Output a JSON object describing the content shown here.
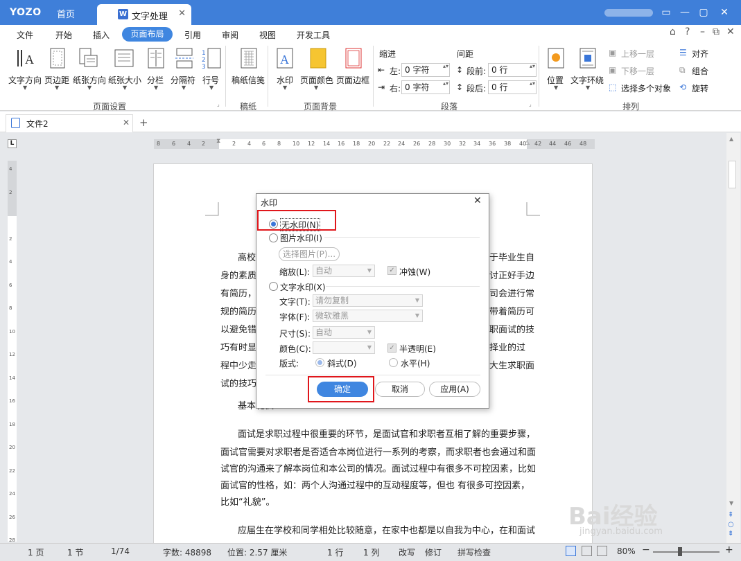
{
  "titlebar": {
    "logo": "YOZO",
    "home_tab": "首页",
    "doc_tab": "文字处理",
    "doc_tab_icon": "W",
    "close": "✕",
    "win_buttons": [
      "▭",
      "—",
      "▢",
      "✕"
    ]
  },
  "menu": {
    "items": [
      "文件",
      "开始",
      "插入",
      "页面布局",
      "引用",
      "审阅",
      "视图",
      "开发工具"
    ],
    "active": "页面布局",
    "right_icons": [
      "⌂",
      "?",
      "–",
      "⧉",
      "✕"
    ]
  },
  "ribbon": {
    "page_setup": {
      "buttons": [
        "文字方向",
        "页边距",
        "纸张方向",
        "纸张大小",
        "分栏",
        "分隔符",
        "行号"
      ],
      "group": "页面设置"
    },
    "paper": {
      "buttons": [
        "稿纸信笺"
      ],
      "group": "稿纸"
    },
    "background": {
      "buttons": [
        "水印",
        "页面颜色",
        "页面边框"
      ],
      "group": "页面背景"
    },
    "paragraph": {
      "indent_title": "缩进",
      "spacing_title": "间距",
      "left_label": "左:",
      "left_value": "0 字符",
      "right_label": "右:",
      "right_value": "0 字符",
      "before_label": "段前:",
      "before_value": "0 行",
      "after_label": "段后:",
      "after_value": "0 行",
      "group": "段落"
    },
    "arrange": {
      "position": "位置",
      "wrap": "文字环绕",
      "bring_forward": "上移一层",
      "send_backward": "下移一层",
      "select_multi": "选择多个对象",
      "align": "对齐",
      "group_btn": "组合",
      "rotate": "旋转",
      "group": "排列"
    }
  },
  "doctab": {
    "name": "文件2",
    "close": "✕",
    "add": "+"
  },
  "ruler": {
    "marks": [
      "8",
      "6",
      "4",
      "2",
      "",
      "2",
      "4",
      "6",
      "8",
      "10",
      "12",
      "14",
      "16",
      "18",
      "20",
      "22",
      "24",
      "26",
      "28",
      "30",
      "32",
      "34",
      "36",
      "38",
      "40",
      "42",
      "44",
      "46",
      "48"
    ],
    "v_marks": [
      "4",
      "2",
      "",
      "2",
      "4",
      "6",
      "8",
      "10",
      "12",
      "14",
      "16",
      "18",
      "20",
      "22",
      "24",
      "26",
      "28"
    ]
  },
  "document": {
    "lines_left": [
      "高校",
      "身的素质",
      "有简历，",
      "规的简历",
      "以避免错",
      "巧有时显",
      "程中少走",
      "试的技巧"
    ],
    "lines_right": [
      "于毕业生自",
      "讨正好手边",
      "司会进行常",
      "带着简历可",
      "职面试的技",
      "择业的过",
      "大生求职面",
      ""
    ],
    "heading": "基本礼仪",
    "para2": [
      "面试是求职过程中很重要的环节，是面试官和求职者互相了解的重要步骤，",
      "面试官需要对求职者是否适合本岗位进行一系列的考察，而求职者也会通过和面",
      "试官的沟通来了解本岗位和本公司的情况。面试过程中有很多不可控因素，比如",
      "面试官的性格，如：两个人沟通过程中的互动程度等，但也  有很多可控因素，",
      "比如“礼貌”。"
    ],
    "para3": "应届生在学校和同学相处比较随意，在家中也都是以自我为中心，在和面试"
  },
  "dialog": {
    "title": "水印",
    "close": "✕",
    "no_watermark": "无水印(N)",
    "picture_watermark": "图片水印(I)",
    "choose_picture": "选择图片(P)...",
    "scale_label": "缩放(L):",
    "scale_value": "自动",
    "washout": "冲蚀(W)",
    "text_watermark": "文字水印(X)",
    "text_label": "文字(T):",
    "text_value": "请勿复制",
    "font_label": "字体(F):",
    "font_value": "微软雅黑",
    "size_label": "尺寸(S):",
    "size_value": "自动",
    "color_label": "颜色(C):",
    "color_value": "",
    "semi": "半透明(E)",
    "layout_label": "版式:",
    "diagonal": "斜式(D)",
    "horizontal": "水平(H)",
    "ok": "确定",
    "cancel": "取消",
    "apply": "应用(A)"
  },
  "statusbar": {
    "page": "1 页",
    "section": "1 节",
    "pages": "1/74",
    "words": "字数: 48898",
    "position": "位置: 2.57 厘米",
    "line": "1 行",
    "col": "1 列",
    "overwrite": "改写",
    "revise": "修订",
    "spell": "拼写检查",
    "zoom": "80%",
    "zoom_minus": "−",
    "zoom_plus": "+"
  },
  "watermark_site": {
    "brand": "Bai经验",
    "url": "jingyan.baidu.com"
  },
  "colors": {
    "title_bg": "#3f7fd9",
    "active_tab": "#3f86e0",
    "ok_button": "#3f86e0",
    "highlight": "#e0161b"
  }
}
